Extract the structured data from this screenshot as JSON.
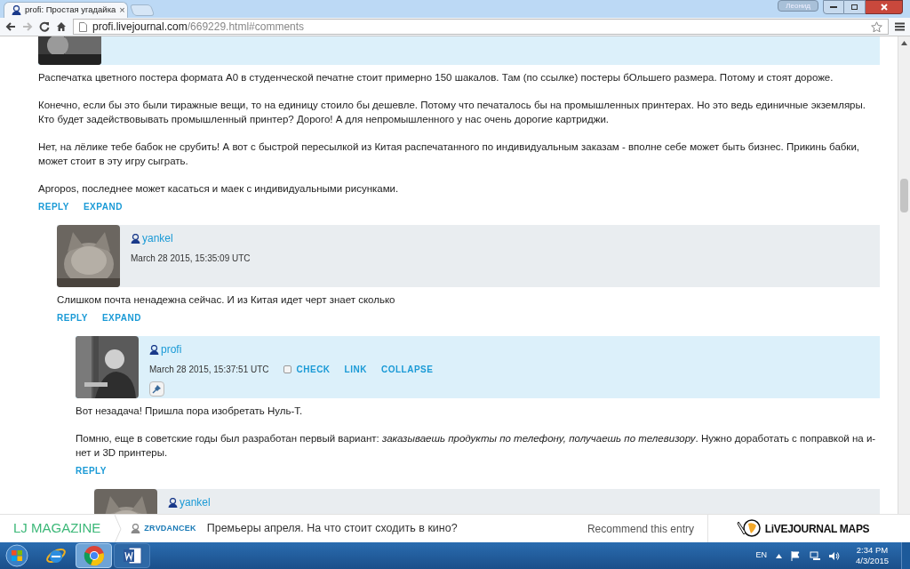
{
  "browser": {
    "tab": {
      "title": "profi: Простая угадайка",
      "close": "×"
    },
    "user_button": "Леонид",
    "address": {
      "host": "profi.livejournal.com",
      "path": "/669229.html#comments"
    }
  },
  "comments": [
    {
      "highlighted": true,
      "avatar": {
        "kind": "picture"
      },
      "paragraphs": [
        "Распечатка цветного постера формата А0 в студенческой печатне стоит примерно 150 шакалов. Там (по ссылке) постеры бОльшего размера. Потому и стоят дороже.",
        "Конечно, если бы это были тиражные вещи, то на единицу стоило бы дешевле. Потому что печаталось бы на промышленных принтерах. Но это ведь единичные экземляры. Кто будет задействовывать промышленный принтер? Дорого! А для непромышленного у нас очень дорогие картриджи.",
        "Нет, на лёлике тебе бабок не срубить! А вот с быстрой пересылкой из Китая распечатанного по индивидуальным заказам - вполне себе может быть бизнес. Прикинь бабки, может стоит в эту игру сыграть.",
        "Apropos, последнее может касаться и маек с индивидуальными рисунками."
      ],
      "actions": [
        "REPLY",
        "EXPAND"
      ],
      "children": [
        {
          "author": "yankel",
          "date": "March 28 2015, 15:35:09 UTC",
          "highlighted": false,
          "avatar": {
            "kind": "picture"
          },
          "paragraphs": [
            "Слишком почта ненадежна сейчас. И из Китая идет черт знает сколько"
          ],
          "actions": [
            "REPLY",
            "EXPAND"
          ],
          "children": [
            {
              "author": "profi",
              "date": "March 28 2015, 15:37:51 UTC",
              "highlighted": true,
              "avatar": {
                "kind": "picture"
              },
              "check": {
                "label": "CHECK",
                "checked": false
              },
              "header_links": [
                "LINK",
                "COLLAPSE"
              ],
              "pin": true,
              "paragraphs": [
                "Вот незадача! Пришла пора изобретать Нуль-Т.",
                "Помню, еще в советские годы был разработан первый вариант: *заказываешь продукты по телефону, получаешь по телевизору*. Нужно доработать с поправкой на и-нет и 3D принтеры."
              ],
              "actions": [
                "REPLY"
              ],
              "children": [
                {
                  "author": "yankel",
                  "highlighted": false,
                  "avatar": {
                    "kind": "picture"
                  }
                }
              ]
            }
          ]
        }
      ]
    }
  ],
  "magazine_bar": {
    "brand": "LJ MAGAZINE",
    "user": "ZRVDANCEK",
    "headline": "Премьеры апреля. На что стоит сходить в кино?",
    "recommend": "Recommend this entry",
    "logo": "LiVEJOURNAL MAPS"
  },
  "taskbar": {
    "apps": [
      {
        "kind": "ie",
        "selected": false
      },
      {
        "kind": "chrome",
        "selected": true
      },
      {
        "kind": "word",
        "selected": false
      }
    ],
    "language": "EN",
    "time": "2:34 PM",
    "date": "4/3/2015"
  }
}
